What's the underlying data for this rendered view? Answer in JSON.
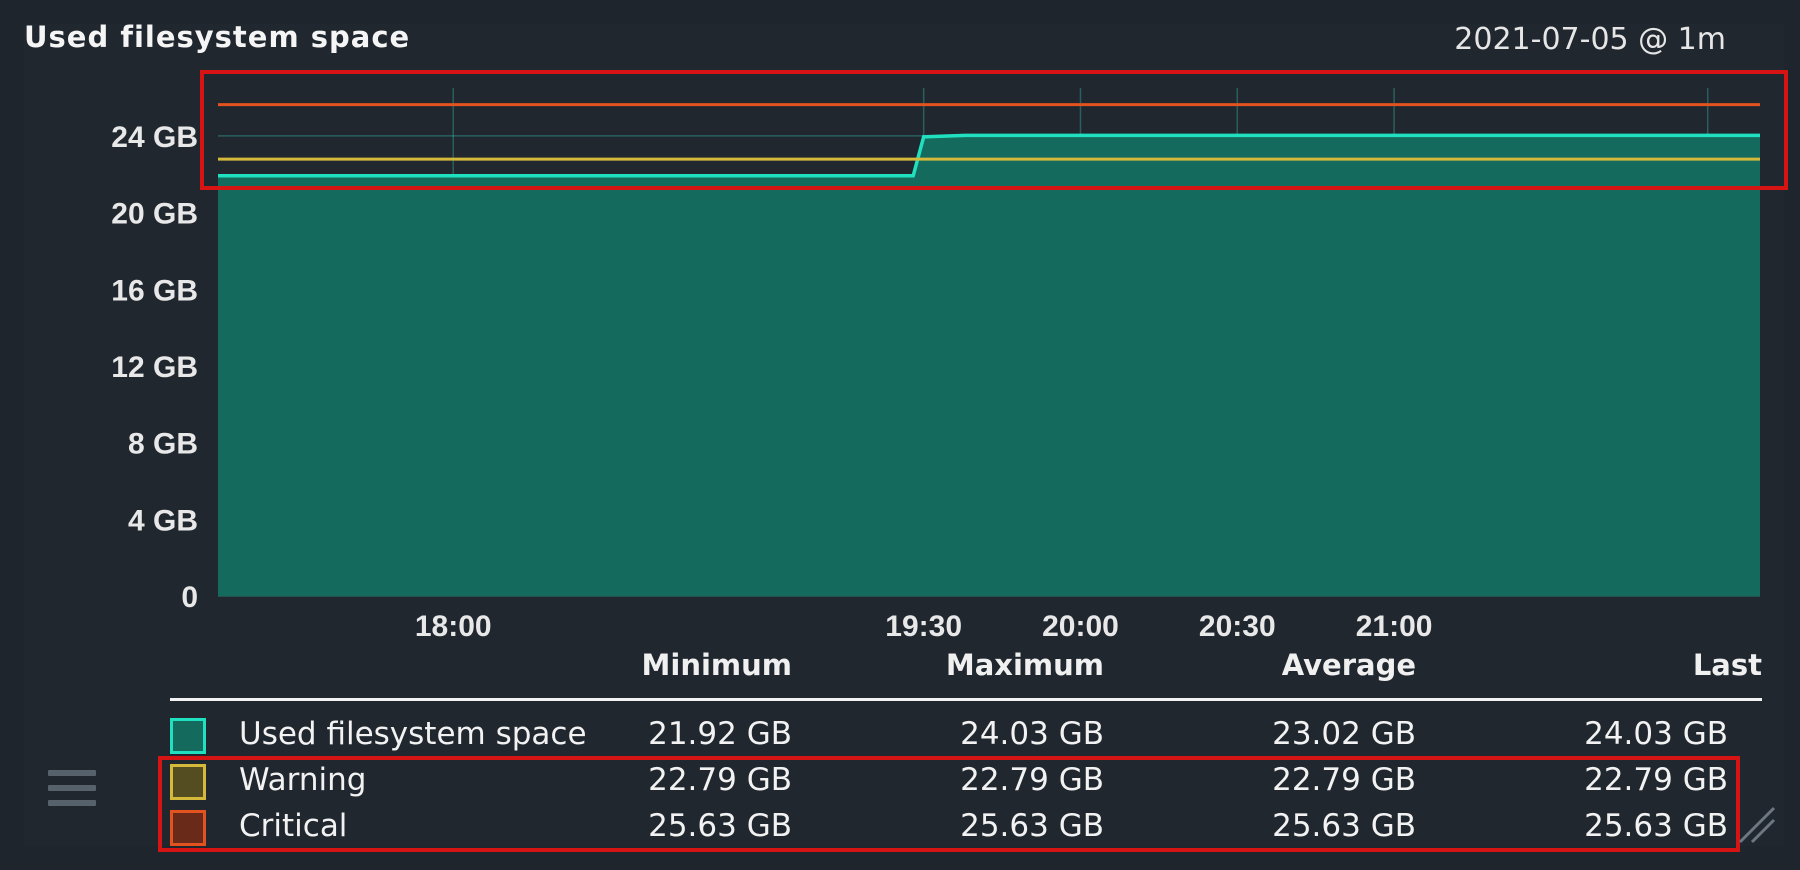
{
  "title": "Used filesystem space",
  "timestamp": "2021-07-05 @ 1m",
  "colors": {
    "area": "#146a5c",
    "line": "#20e0c0",
    "warning": "#d4b93a",
    "critical": "#e2531f",
    "highlight": "#d61414"
  },
  "chart_data": {
    "type": "area",
    "x_ticks": [
      "18:00",
      "19:30",
      "20:00",
      "20:30",
      "21:00"
    ],
    "y_ticks": [
      "0",
      "4 GB",
      "8 GB",
      "12 GB",
      "16 GB",
      "20 GB",
      "24 GB"
    ],
    "ylim": [
      0,
      26.5
    ],
    "xlim": [
      "17:15",
      "22:10"
    ],
    "grid": true,
    "series": [
      {
        "name": "Used filesystem space",
        "x": [
          "17:15",
          "19:28",
          "19:30",
          "19:38",
          "22:10"
        ],
        "values": [
          21.92,
          21.92,
          23.95,
          24.03,
          24.03
        ]
      },
      {
        "name": "Warning",
        "x": [
          "17:15",
          "22:10"
        ],
        "values": [
          22.79,
          22.79
        ]
      },
      {
        "name": "Critical",
        "x": [
          "17:15",
          "22:10"
        ],
        "values": [
          25.63,
          25.63
        ]
      }
    ]
  },
  "legend": {
    "headers": [
      "Minimum",
      "Maximum",
      "Average",
      "Last"
    ],
    "rows": [
      {
        "name": "Used filesystem space",
        "color": "#20e0c0",
        "fill": "#146a5c",
        "values": [
          "21.92 GB",
          "24.03 GB",
          "23.02 GB",
          "24.03 GB"
        ]
      },
      {
        "name": "Warning",
        "color": "#d4b93a",
        "fill": "#554d22",
        "values": [
          "22.79 GB",
          "22.79 GB",
          "22.79 GB",
          "22.79 GB"
        ]
      },
      {
        "name": "Critical",
        "color": "#e2531f",
        "fill": "#6a2a1a",
        "values": [
          "25.63 GB",
          "25.63 GB",
          "25.63 GB",
          "25.63 GB"
        ]
      }
    ]
  }
}
